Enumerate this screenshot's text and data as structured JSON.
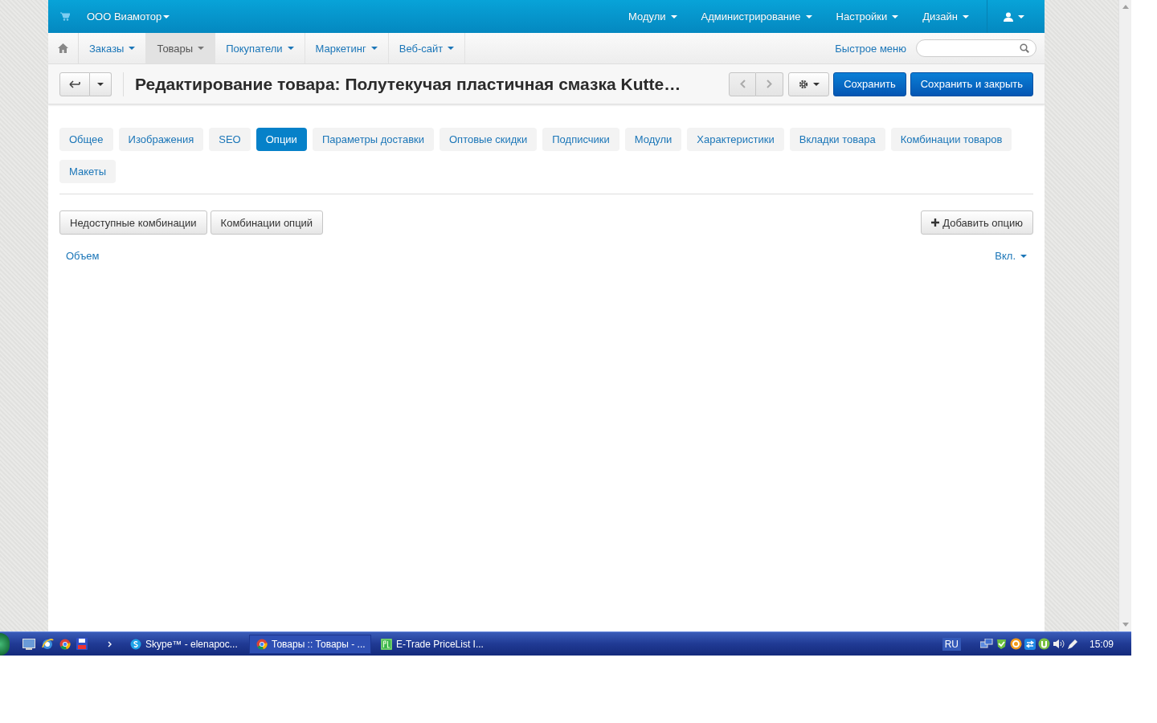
{
  "brand": {
    "label": "ООО Виамотор"
  },
  "top_menu": [
    {
      "label": "Модули"
    },
    {
      "label": "Администрирование"
    },
    {
      "label": "Настройки"
    },
    {
      "label": "Дизайн"
    }
  ],
  "nav_tabs": [
    {
      "label": "Заказы",
      "selected": false
    },
    {
      "label": "Товары",
      "selected": true
    },
    {
      "label": "Покупатели",
      "selected": false
    },
    {
      "label": "Маркетинг",
      "selected": false
    },
    {
      "label": "Веб-сайт",
      "selected": false
    }
  ],
  "quick_menu": {
    "label": "Быстрое меню"
  },
  "header": {
    "title": "Редактирование товара: Полутекучая пластичная смазка Kutte…",
    "buttons": [
      "Сохранить",
      "Сохранить и закрыть"
    ]
  },
  "tabs": [
    {
      "label": "Общее",
      "selected": false
    },
    {
      "label": "Изображения",
      "selected": false
    },
    {
      "label": "SEO",
      "selected": false
    },
    {
      "label": "Опции",
      "selected": true
    },
    {
      "label": "Параметры доставки",
      "selected": false
    },
    {
      "label": "Оптовые скидки",
      "selected": false
    },
    {
      "label": "Подписчики",
      "selected": false
    },
    {
      "label": "Модули",
      "selected": false
    },
    {
      "label": "Характеристики",
      "selected": false
    },
    {
      "label": "Вкладки товара",
      "selected": false
    },
    {
      "label": "Комбинации товаров",
      "selected": false
    },
    {
      "label": "Макеты",
      "selected": false
    }
  ],
  "option_buttons": [
    "Недоступные комбинации",
    "Комбинации опций"
  ],
  "add_button": "Добавить опцию",
  "options": [
    {
      "name": "Объем",
      "status": "Вкл."
    }
  ],
  "taskbar": {
    "items": [
      {
        "label": "Skype™ - elenapoc...",
        "kind": "skype",
        "selected": false
      },
      {
        "label": "Товары :: Товары - ...",
        "kind": "chrome",
        "selected": true
      },
      {
        "label": "E-Trade PriceList I...",
        "kind": "pricelist",
        "selected": false
      }
    ],
    "language": "RU",
    "clock": "15:09"
  }
}
